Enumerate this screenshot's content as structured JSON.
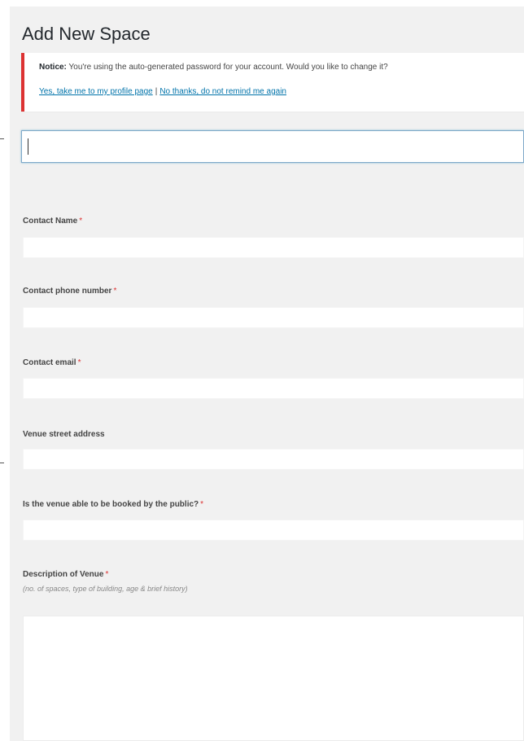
{
  "page": {
    "title": "Add New Space"
  },
  "notice": {
    "label": "Notice:",
    "message": "You're using the auto-generated password for your account. Would you like to change it?",
    "link_yes": "Yes, take me to my profile page",
    "separator": "|",
    "link_no": "No thanks, do not remind me again",
    "accent_color": "#dc3232"
  },
  "title_input": {
    "value": "",
    "placeholder": ""
  },
  "fields": [
    {
      "label": "Contact Name",
      "required": "*",
      "value": ""
    },
    {
      "label": "Contact phone number",
      "required": "*",
      "value": ""
    },
    {
      "label": "Contact email",
      "required": "*",
      "value": ""
    },
    {
      "label": "Venue street address",
      "required": "",
      "value": ""
    },
    {
      "label": "Is the venue able to be booked by the public?",
      "required": "*",
      "value": ""
    }
  ],
  "description": {
    "label": "Description of Venue",
    "required": "*",
    "hint": "(no. of spaces, type of building, age & brief history)",
    "value": ""
  },
  "colors": {
    "link": "#0073aa",
    "required": "#dc3232",
    "panel_bg": "#f1f1f1"
  }
}
